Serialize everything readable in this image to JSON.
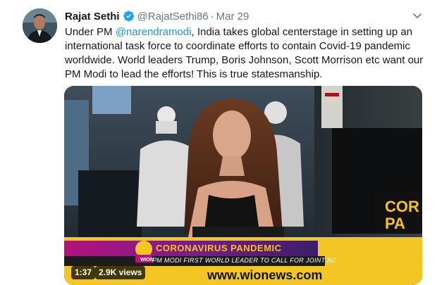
{
  "author": {
    "name": "Rajat Sethi",
    "handle": "@RajatSethi86",
    "separator": "·",
    "date": "Mar 29"
  },
  "tweet": {
    "text_before": "Under PM ",
    "mention": "@narendramodi",
    "text_after": ", India takes global centerstage in setting up an international task force to coordinate efforts to contain Covid-19 pandemic worldwide. World leaders Trump, Boris Johnson, Scott Morrison etc want our PM Modi to lead the efforts! This is true statesmanship."
  },
  "video": {
    "duration": "1:37",
    "views": "2.9K views",
    "ticker_main": "CORONAVIRUS PANDEMIC",
    "ticker_sub": "PM MODI FIRST WORLD LEADER TO CALL FOR JOINT AC",
    "url": "www.wionews.com",
    "logo": "WION",
    "side_text_1": "COR",
    "side_text_2": "PA"
  },
  "colors": {
    "link": "#1b95e0",
    "verified": "#1da1f2",
    "secondary_text": "#657786",
    "ticker_yellow": "#f6c21c"
  },
  "icons": [
    "verified-badge-icon",
    "chevron-down-icon"
  ]
}
